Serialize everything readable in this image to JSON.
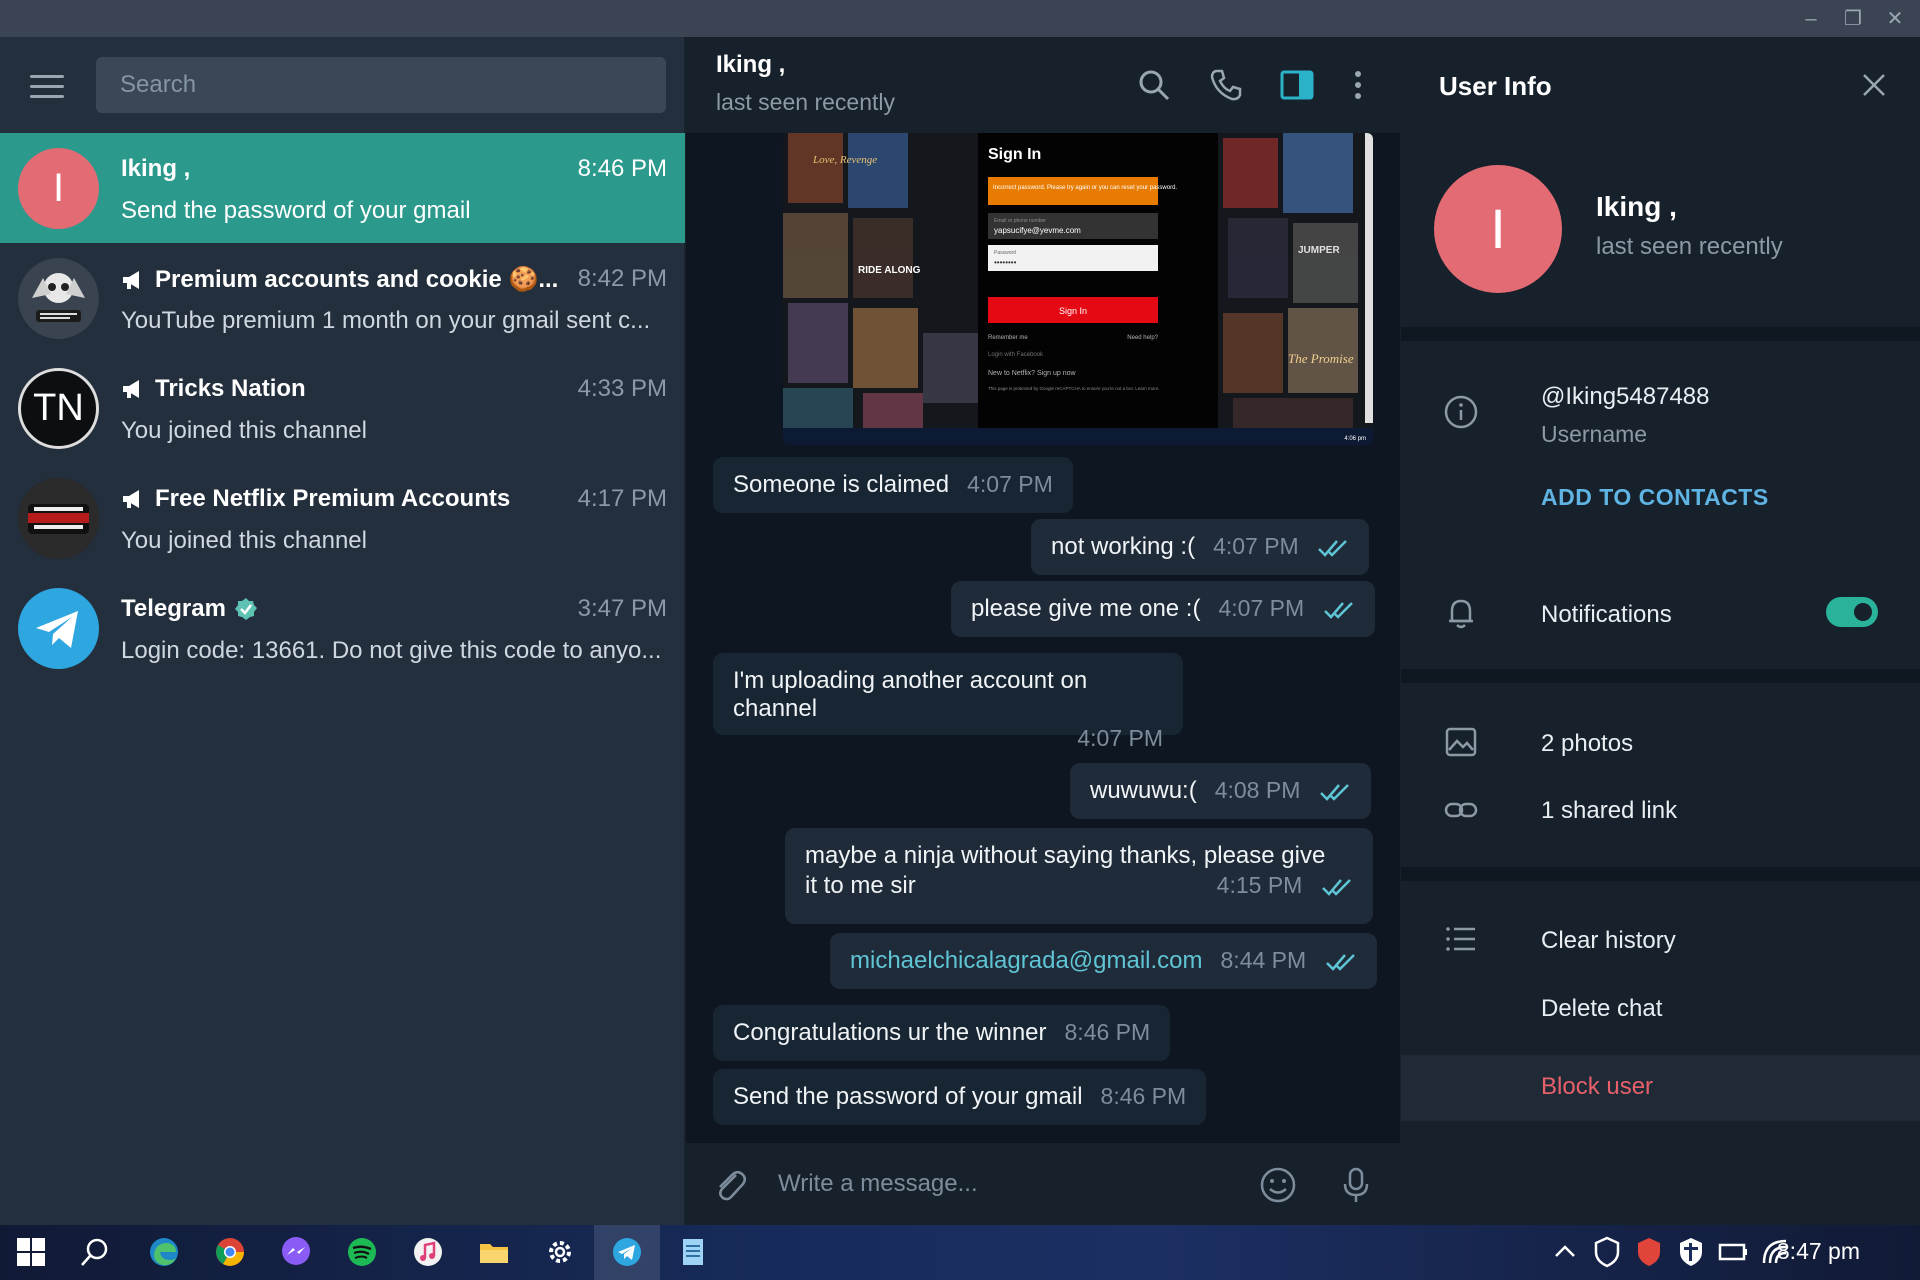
{
  "window": {
    "minimize": "–",
    "restore": "❐",
    "close": "✕"
  },
  "search": {
    "placeholder": "Search"
  },
  "chats": [
    {
      "name": "Iking ,",
      "time": "8:46 PM",
      "preview": "Send the password of your gmail",
      "avatar_letter": "I",
      "avatar_color": "#e36b73",
      "active": true
    },
    {
      "name": "Premium accounts and cookie 🍪...",
      "time": "8:42 PM",
      "preview": "YouTube premium 1 month on your gmail sent c...",
      "channel": true
    },
    {
      "name": "Tricks Nation",
      "time": "4:33 PM",
      "preview": "You joined this channel",
      "avatar_letter": "TN",
      "channel": true
    },
    {
      "name": "Free Netflix Premium Accounts",
      "time": "4:17 PM",
      "preview": "You joined this channel",
      "channel": true,
      "avatar_text": "FREE NETFLIX ACCOUNT"
    },
    {
      "name": "Telegram",
      "time": "3:47 PM",
      "preview": "Login code: 13661. Do not give this code to anyo...",
      "verified": true
    }
  ],
  "chat_header": {
    "peer": "Iking ,",
    "status": "last seen recently"
  },
  "photo": {
    "title": "Sign In",
    "alert": "Incorrect password. Please try again or you can reset your password.",
    "email_label": "Email or phone number",
    "email": "yapsucifye@yevme.com",
    "password_label": "Password",
    "password_mask": "••••••••",
    "signin_btn": "Sign In",
    "remember": "Remember me",
    "need_help": "Need help?",
    "facebook": "Login with Facebook",
    "new_to": "New to Netflix? Sign up now",
    "captcha": "This page is protected by Google reCAPTCHA to ensure you're not a bot. Learn more.",
    "poster_1": "Love, Revenge",
    "poster_2": "RIDE ALONG",
    "poster_3": "JUMPER",
    "poster_4": "The Promise",
    "taskbar_time": "4:06 pm"
  },
  "messages": [
    {
      "dir": "in",
      "text": "Someone is claimed",
      "time": "4:07 PM"
    },
    {
      "dir": "out",
      "text": "not working :(",
      "time": "4:07 PM"
    },
    {
      "dir": "out",
      "text": "please give me one :(",
      "time": "4:07 PM"
    },
    {
      "dir": "in",
      "text": "I'm uploading another account on channel",
      "time": "4:07 PM"
    },
    {
      "dir": "out",
      "text": "wuwuwu:(",
      "time": "4:08 PM"
    },
    {
      "dir": "out",
      "text_line1": "maybe a ninja without saying thanks, please give",
      "text_line2": "it to me sir",
      "time": "4:15 PM"
    },
    {
      "dir": "out",
      "text": "michaelchicalagrada@gmail.com",
      "time": "8:44 PM"
    },
    {
      "dir": "in",
      "text": "Congratulations ur the winner",
      "time": "8:46 PM"
    },
    {
      "dir": "in",
      "text": "Send the password of your gmail",
      "time": "8:46 PM"
    }
  ],
  "composer": {
    "placeholder": "Write a message..."
  },
  "user_info": {
    "title": "User Info",
    "avatar_letter": "I",
    "name": "Iking ,",
    "status": "last seen recently",
    "username": "@Iking5487488",
    "username_label": "Username",
    "add_to_contacts": "ADD TO CONTACTS",
    "notifications": "Notifications",
    "notifications_on": true,
    "photos": "2 photos",
    "shared_link": "1 shared link",
    "clear_history": "Clear history",
    "delete_chat": "Delete chat",
    "block_user": "Block user"
  },
  "taskbar": {
    "clock": "8:47 pm"
  },
  "colors": {
    "accent": "#2b9a8c",
    "link": "#5fc4d4",
    "danger": "#e8606a",
    "toggle": "#2ab29a"
  }
}
